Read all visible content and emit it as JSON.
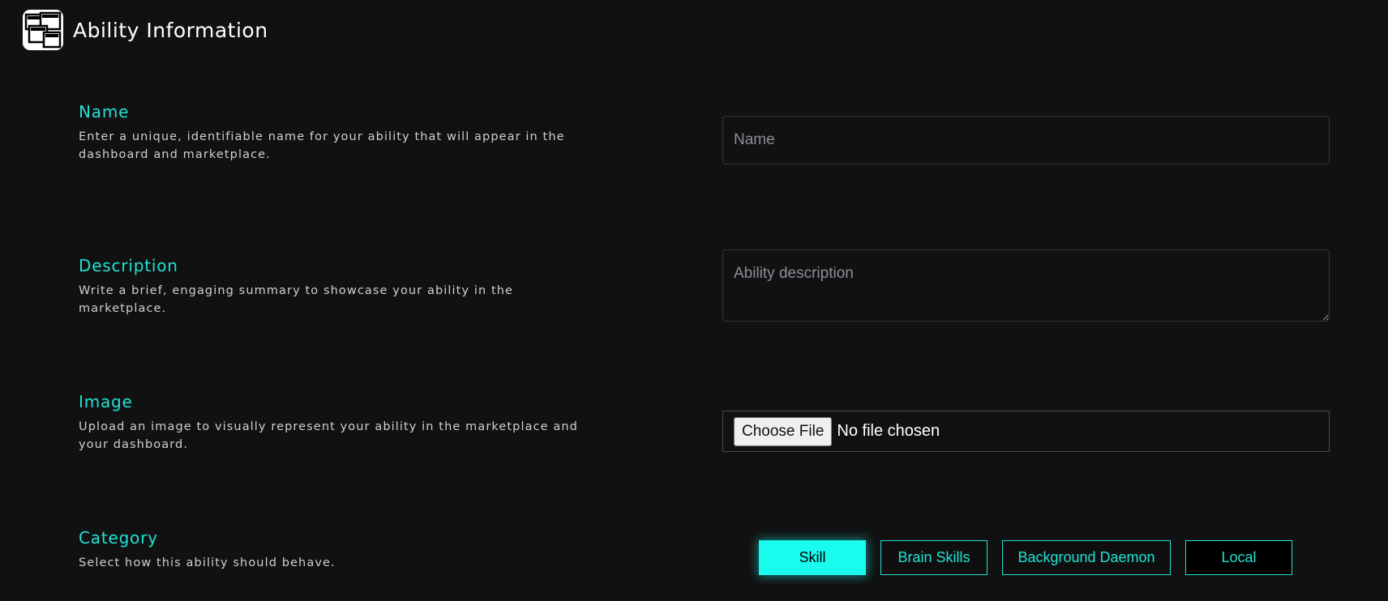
{
  "header": {
    "title": "Ability Information",
    "logo_icon": "openhome-logo-icon"
  },
  "sections": {
    "name": {
      "label": "Name",
      "help": "Enter a unique, identifiable name for your ability that will appear in the dashboard and marketplace.",
      "placeholder": "Name",
      "value": ""
    },
    "description": {
      "label": "Description",
      "help": "Write a brief, engaging summary to showcase your ability in the marketplace.",
      "placeholder": "Ability description",
      "value": ""
    },
    "image": {
      "label": "Image",
      "help": "Upload an image to visually represent your ability in the marketplace and your dashboard.",
      "button_label": "Choose File",
      "status": "No file chosen"
    },
    "category": {
      "label": "Category",
      "help": "Select how this ability should behave.",
      "options": [
        "Skill",
        "Brain Skills",
        "Background Daemon",
        "Local"
      ],
      "selected": "Skill"
    }
  },
  "colors": {
    "accent": "#21e2d6",
    "accent_fill": "#1afbef",
    "background": "#111111"
  }
}
